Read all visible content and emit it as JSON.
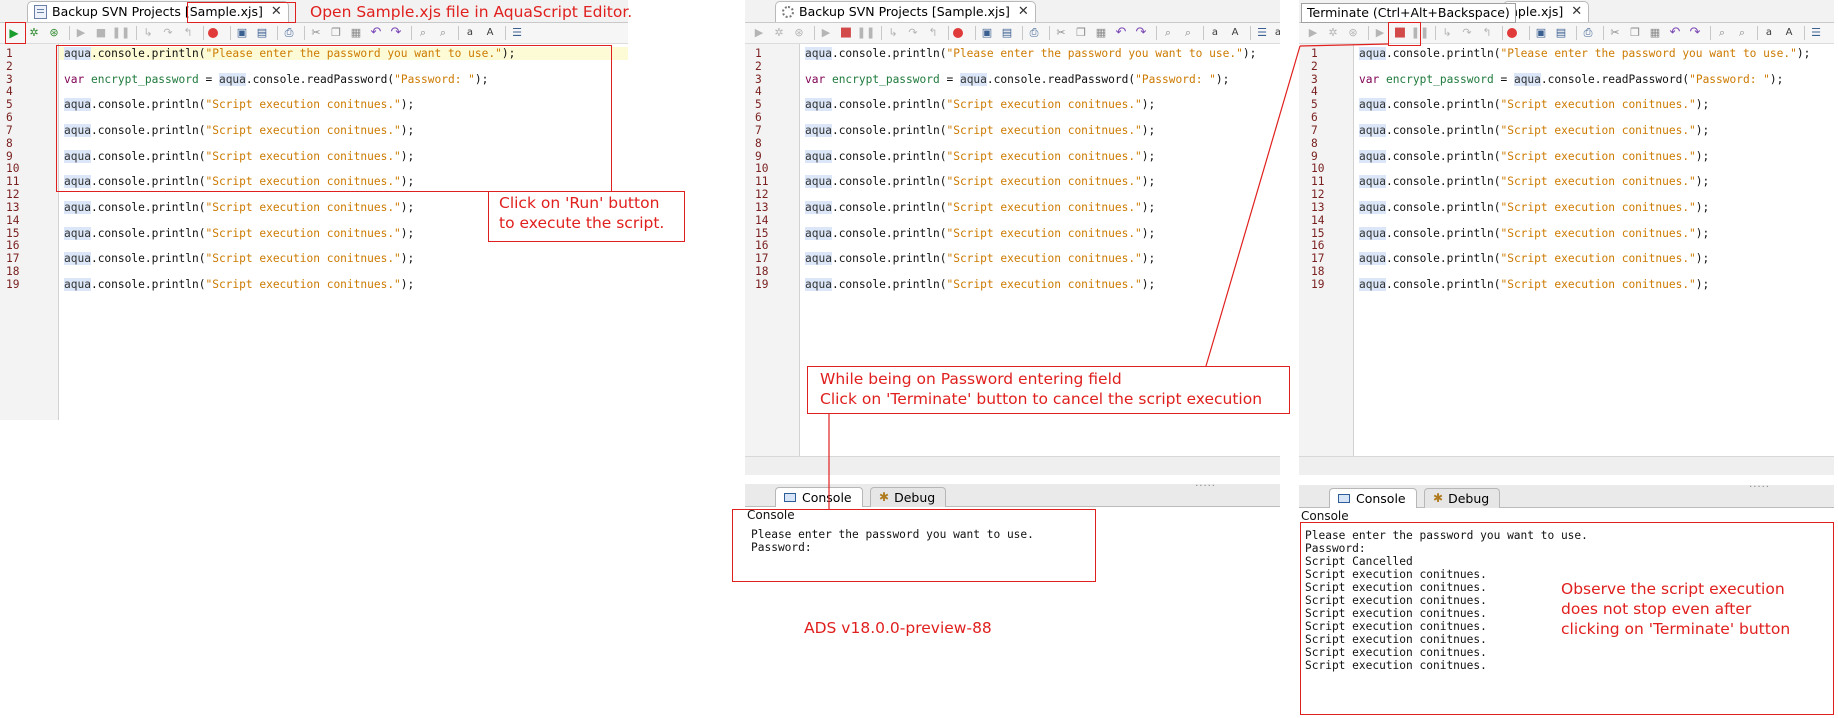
{
  "panels": [
    {
      "tab_title": "Backup SVN Projects [Sample.xjs]",
      "tab_close": "✕"
    },
    {
      "tab_title": "Backup SVN Projects [Sample.xjs]",
      "tab_close": "✕",
      "console_tab": "Console",
      "debug_tab": "Debug",
      "console_title": "Console",
      "console_lines": [
        "Please enter the password you want to use.",
        "Password:"
      ]
    },
    {
      "tab_title": "nple.xjs]",
      "tab_close": "✕",
      "tooltip": "Terminate (Ctrl+Alt+Backspace)",
      "console_tab": "Console",
      "debug_tab": "Debug",
      "console_title": "Console",
      "console_lines": [
        "Please enter the password you want to use.",
        "Password:",
        "Script Cancelled",
        "Script execution conitnues.",
        "Script execution conitnues.",
        "Script execution conitnues.",
        "Script execution conitnues.",
        "Script execution conitnues.",
        "Script execution conitnues.",
        "Script execution conitnues.",
        "Script execution conitnues."
      ]
    }
  ],
  "toolbar_extra": {
    "font_down": "a",
    "font_up": "A",
    "trailing": "a"
  },
  "code": {
    "line_numbers": [
      "1",
      "2",
      "3",
      "4",
      "5",
      "6",
      "7",
      "8",
      "9",
      "10",
      "11",
      "12",
      "13",
      "14",
      "15",
      "16",
      "17",
      "18",
      "19"
    ],
    "line1": {
      "obj": "aqua",
      "method": ".console.println(",
      "string": "\"Please enter the password you want to use.\"",
      "end": ");"
    },
    "line3": {
      "kw": "var",
      "name": "encrypt_password",
      "eq": " = ",
      "obj": "aqua",
      "method": ".console.readPassword(",
      "string": "\"Password: \"",
      "end": ");"
    },
    "repeat": {
      "obj": "aqua",
      "method": ".console.println(",
      "string": "\"Script execution conitnues.\"",
      "end": ");"
    }
  },
  "annotations": {
    "open_file": "Open Sample.xjs file in AquaScript Editor.",
    "click_run": [
      "Click on 'Run' button",
      "to execute the script."
    ],
    "terminate": [
      "While being on Password entering field",
      "Click on 'Terminate' button to cancel the script execution"
    ],
    "version": "ADS v18.0.0-preview-88",
    "observe": [
      "Observe the script execution",
      "does not stop even after",
      "clicking on 'Terminate' button"
    ]
  },
  "colors": {
    "annotation_red": "#e0201e",
    "string": "#cc7a00",
    "keyword": "#7f0055",
    "line_number": "#7a1f1f"
  },
  "icons": [
    "run-icon",
    "debug-icon",
    "run-debug-icon",
    "resume-icon",
    "stop-icon",
    "pause-icon",
    "step-into-icon",
    "step-over-icon",
    "step-return-icon",
    "breakpoint-icon",
    "save-icon",
    "save-all-icon",
    "print-icon",
    "cut-icon",
    "copy-icon",
    "paste-icon",
    "undo-icon",
    "redo-icon",
    "find-icon",
    "replace-icon",
    "font-decrease-icon",
    "font-increase-icon",
    "outline-icon"
  ]
}
